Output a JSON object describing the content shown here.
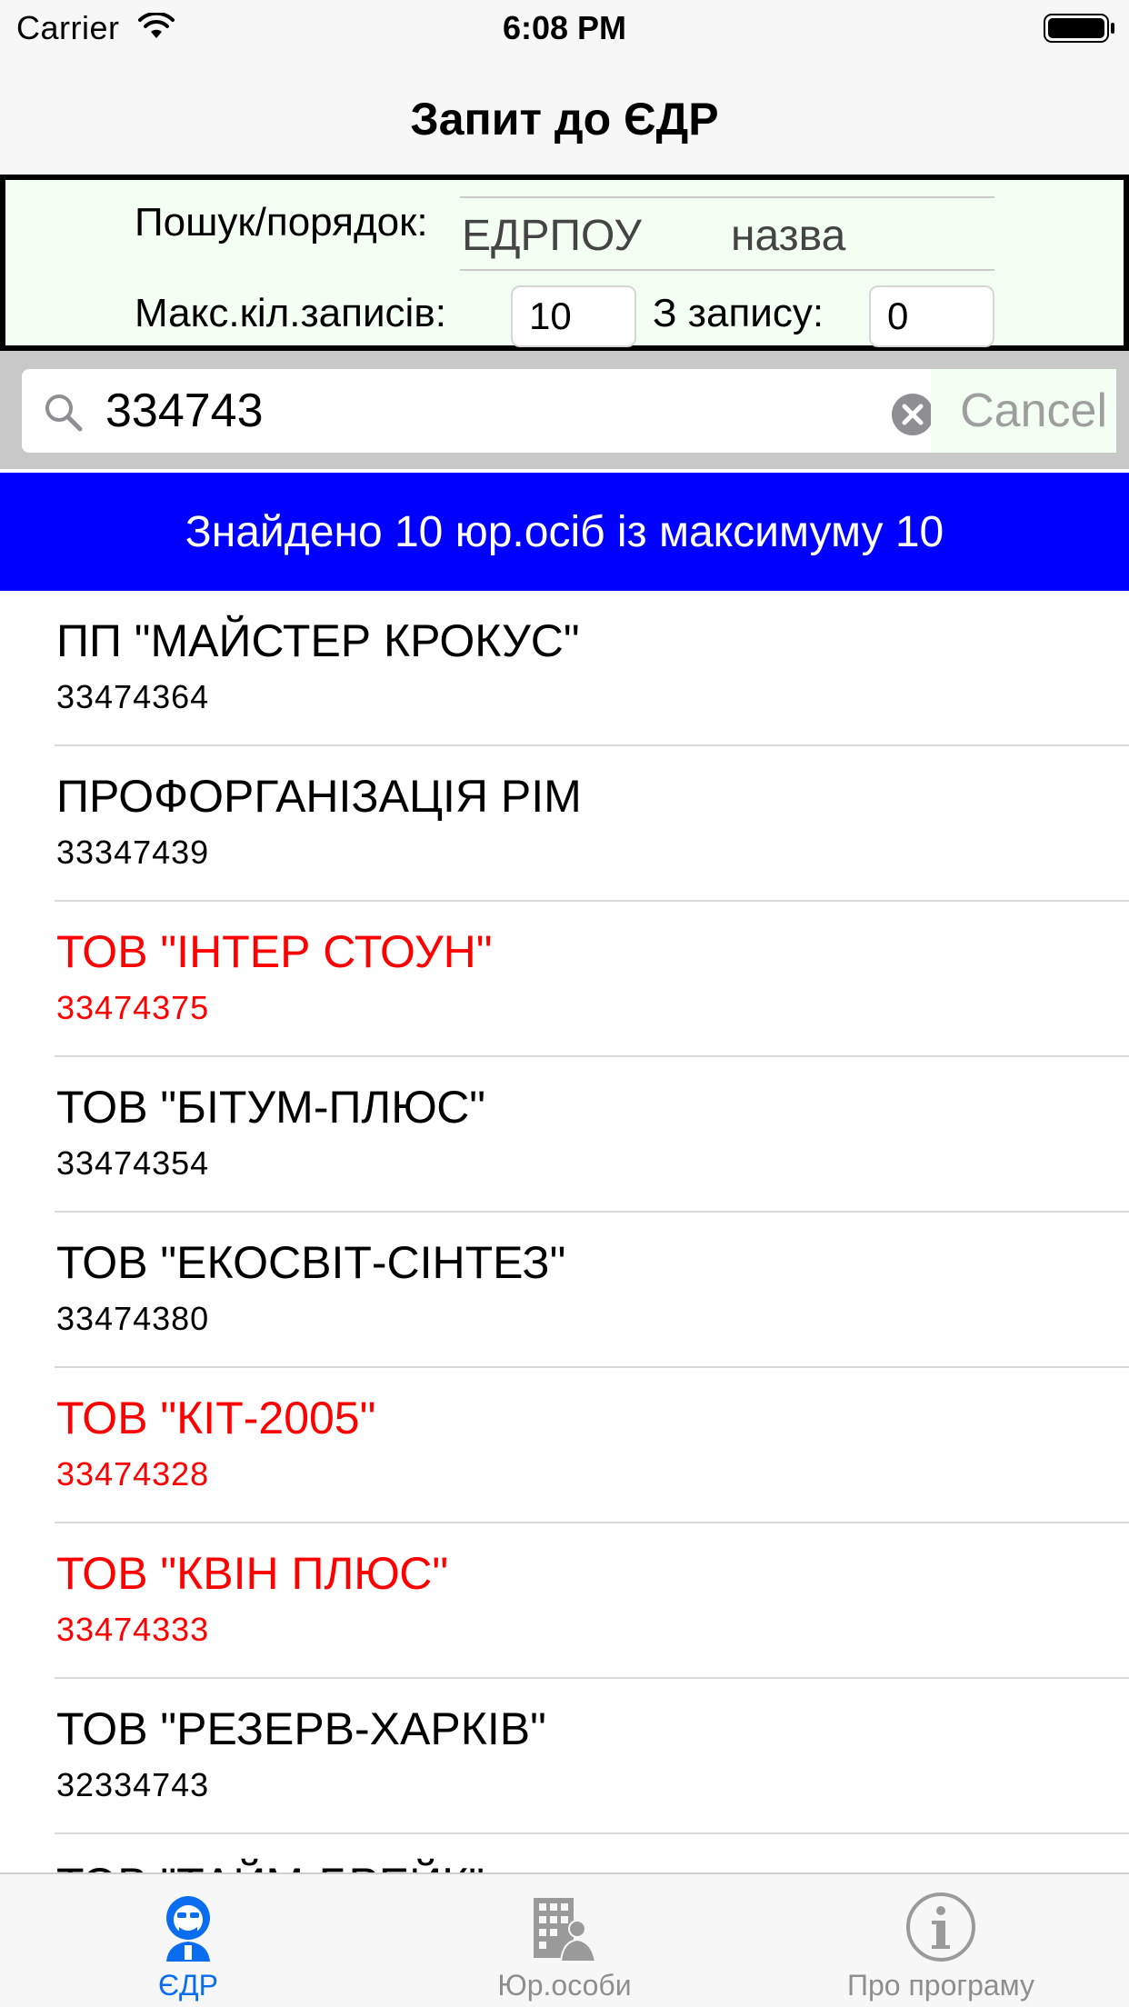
{
  "status_bar": {
    "carrier": "Carrier",
    "time": "6:08 PM"
  },
  "nav": {
    "title": "Запит до ЄДР"
  },
  "filter": {
    "search_order_label": "Пошук/порядок:",
    "segments": [
      "ЕДРПОУ",
      "назва"
    ],
    "max_records_label": "Макс.кіл.записів:",
    "max_records_value": "10",
    "from_record_label": "З запису:",
    "from_record_value": "0"
  },
  "search": {
    "query": "334743",
    "cancel_label": "Cancel"
  },
  "banner": {
    "text": "Знайдено 10 юр.осіб із максимуму 10"
  },
  "results": [
    {
      "name": "ПП \"МАЙСТЕР КРОКУС\"",
      "code": "33474364",
      "highlight": false
    },
    {
      "name": "ПРОФОРГАНІЗАЦІЯ РІМ",
      "code": "33347439",
      "highlight": false
    },
    {
      "name": "ТОВ \"ІНТЕР СТОУН\"",
      "code": "33474375",
      "highlight": true
    },
    {
      "name": "ТОВ \"БІТУМ-ПЛЮС\"",
      "code": "33474354",
      "highlight": false
    },
    {
      "name": "ТОВ \"ЕКОСВІТ-СІНТЕЗ\"",
      "code": "33474380",
      "highlight": false
    },
    {
      "name": "ТОВ \"КІТ-2005\"",
      "code": "33474328",
      "highlight": true
    },
    {
      "name": "ТОВ \"КВІН ПЛЮС\"",
      "code": "33474333",
      "highlight": true
    },
    {
      "name": "ТОВ \"РЕЗЕРВ-ХАРКІВ\"",
      "code": "32334743",
      "highlight": false
    },
    {
      "name": "ТОВ \"ТАЙМ-БРЕЙК\"",
      "code": "",
      "highlight": false
    }
  ],
  "tabs": [
    {
      "label": "ЄДР",
      "icon": "edr-person-icon",
      "active": true
    },
    {
      "label": "Юр.особи",
      "icon": "building-people-icon",
      "active": false
    },
    {
      "label": "Про програму",
      "icon": "info-icon",
      "active": false
    }
  ],
  "colors": {
    "banner": "#0000ff",
    "highlight_text": "#ff0000",
    "active_tab": "#0a6df0"
  }
}
